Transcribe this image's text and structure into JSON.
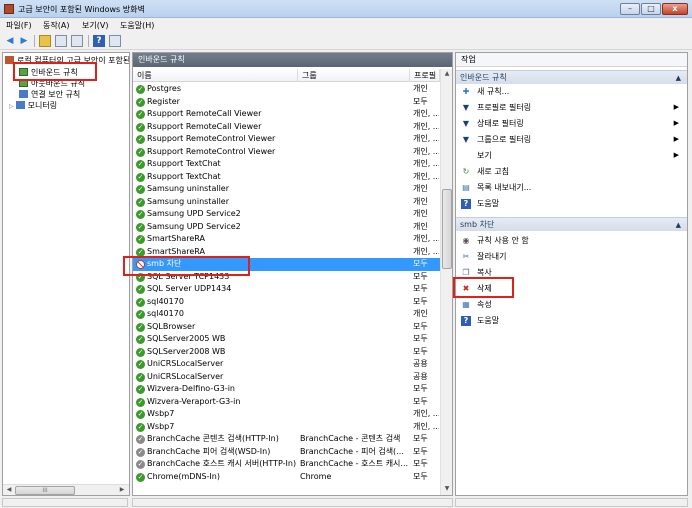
{
  "window": {
    "title": "고급 보안이 포함된 Windows 방화벽"
  },
  "menu": [
    "파일(F)",
    "동작(A)",
    "보기(V)",
    "도움말(H)"
  ],
  "tree": {
    "root": "로컬 컴퓨터의 고급 보안이 포함된",
    "items": [
      "인바운드 규칙",
      "아웃바운드 규칙",
      "연결 보안 규칙",
      "모니터링"
    ]
  },
  "middle": {
    "header": "인바운드 규칙",
    "columns": {
      "name": "이름",
      "group": "그룹",
      "profile": "프로필"
    },
    "rows": [
      {
        "name": "Postgres",
        "group": "",
        "profile": "개인",
        "state": "on"
      },
      {
        "name": "Register",
        "group": "",
        "profile": "모두",
        "state": "on"
      },
      {
        "name": "Rsupport RemoteCall Viewer",
        "group": "",
        "profile": "개인, ...",
        "state": "on"
      },
      {
        "name": "Rsupport RemoteCall Viewer",
        "group": "",
        "profile": "개인, ...",
        "state": "on"
      },
      {
        "name": "Rsupport RemoteControl Viewer",
        "group": "",
        "profile": "개인, ...",
        "state": "on"
      },
      {
        "name": "Rsupport RemoteControl Viewer",
        "group": "",
        "profile": "개인, ...",
        "state": "on"
      },
      {
        "name": "Rsupport TextChat",
        "group": "",
        "profile": "개인, ...",
        "state": "on"
      },
      {
        "name": "Rsupport TextChat",
        "group": "",
        "profile": "개인, ...",
        "state": "on"
      },
      {
        "name": "Samsung uninstaller",
        "group": "",
        "profile": "개인",
        "state": "on"
      },
      {
        "name": "Samsung uninstaller",
        "group": "",
        "profile": "개인",
        "state": "on"
      },
      {
        "name": "Samsung UPD Service2",
        "group": "",
        "profile": "개인",
        "state": "on"
      },
      {
        "name": "Samsung UPD Service2",
        "group": "",
        "profile": "개인",
        "state": "on"
      },
      {
        "name": "SmartShareRA",
        "group": "",
        "profile": "개인, ...",
        "state": "on"
      },
      {
        "name": "SmartShareRA",
        "group": "",
        "profile": "개인, ...",
        "state": "on"
      },
      {
        "name": "smb 차단",
        "group": "",
        "profile": "모두",
        "state": "block",
        "selected": true
      },
      {
        "name": "SQL Server TCP1433",
        "group": "",
        "profile": "모두",
        "state": "on"
      },
      {
        "name": "SQL Server UDP1434",
        "group": "",
        "profile": "모두",
        "state": "on"
      },
      {
        "name": "sql40170",
        "group": "",
        "profile": "모두",
        "state": "on"
      },
      {
        "name": "sql40170",
        "group": "",
        "profile": "개인",
        "state": "on"
      },
      {
        "name": "SQLBrowser",
        "group": "",
        "profile": "모두",
        "state": "on"
      },
      {
        "name": "SQLServer2005 WB",
        "group": "",
        "profile": "모두",
        "state": "on"
      },
      {
        "name": "SQLServer2008 WB",
        "group": "",
        "profile": "모두",
        "state": "on"
      },
      {
        "name": "UniCRSLocalServer",
        "group": "",
        "profile": "공용",
        "state": "on"
      },
      {
        "name": "UniCRSLocalServer",
        "group": "",
        "profile": "공용",
        "state": "on"
      },
      {
        "name": "Wizvera-Delfino-G3-in",
        "group": "",
        "profile": "모두",
        "state": "on"
      },
      {
        "name": "Wizvera-Veraport-G3-in",
        "group": "",
        "profile": "모두",
        "state": "on"
      },
      {
        "name": "Wsbp7",
        "group": "",
        "profile": "개인, ...",
        "state": "on"
      },
      {
        "name": "Wsbp7",
        "group": "",
        "profile": "개인, ...",
        "state": "on"
      },
      {
        "name": "BranchCache 콘텐츠 검색(HTTP-In)",
        "group": "BranchCache - 콘텐츠 검색",
        "profile": "모두",
        "state": "off"
      },
      {
        "name": "BranchCache 피어 검색(WSD-In)",
        "group": "BranchCache - 피어 검색(...",
        "profile": "모두",
        "state": "off"
      },
      {
        "name": "BranchCache 호스트 캐시 서버(HTTP-In)",
        "group": "BranchCache - 호스트 캐시...",
        "profile": "모두",
        "state": "off"
      },
      {
        "name": "Chrome(mDNS-In)",
        "group": "Chrome",
        "profile": "모두",
        "state": "on"
      }
    ]
  },
  "actions": {
    "header": "작업",
    "section1": {
      "title": "인바운드 규칙",
      "items": [
        {
          "label": "새 규칙...",
          "icon": "new-rule-icon",
          "submenu": false
        },
        {
          "label": "프로필로 필터링",
          "icon": "filter-icon",
          "submenu": true
        },
        {
          "label": "상태로 필터링",
          "icon": "filter-icon",
          "submenu": true
        },
        {
          "label": "그룹으로 필터링",
          "icon": "filter-icon",
          "submenu": true
        },
        {
          "label": "보기",
          "icon": "",
          "submenu": true
        },
        {
          "label": "새로 고침",
          "icon": "refresh-icon",
          "submenu": false
        },
        {
          "label": "목록 내보내기...",
          "icon": "export-icon",
          "submenu": false
        },
        {
          "label": "도움말",
          "icon": "help-icon",
          "submenu": false
        }
      ]
    },
    "section2": {
      "title": "smb 차단",
      "items": [
        {
          "label": "규칙 사용 안 함",
          "icon": "disable-icon"
        },
        {
          "label": "잘라내기",
          "icon": "cut-icon"
        },
        {
          "label": "복사",
          "icon": "copy-icon"
        },
        {
          "label": "삭제",
          "icon": "delete-icon"
        },
        {
          "label": "속성",
          "icon": "properties-icon"
        },
        {
          "label": "도움말",
          "icon": "help-icon"
        }
      ]
    }
  },
  "colors": {
    "selection": "#3399ff",
    "highlight_box": "#e0201a",
    "pane_header": "#5f6b79"
  }
}
